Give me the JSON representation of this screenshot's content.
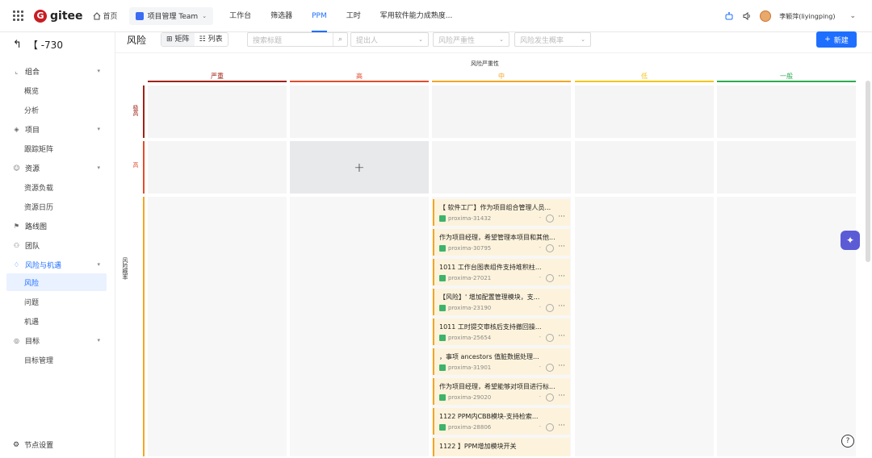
{
  "topbar": {
    "logo_text": "gitee",
    "home_label": "首页",
    "team_label": "项目管理 Team",
    "nav": [
      "工作台",
      "筛选器",
      "PPM",
      "工时",
      "军用软件能力成熟度..."
    ],
    "active_nav": "PPM",
    "user_name": "李颖萍(liyingping)"
  },
  "sidebar": {
    "project_name": "【    -730",
    "items": [
      {
        "type": "group",
        "label": "组合",
        "icon": "chart-icon"
      },
      {
        "type": "sub",
        "label": "概览"
      },
      {
        "type": "sub",
        "label": "分析"
      },
      {
        "type": "group",
        "label": "项目",
        "icon": "layers-icon"
      },
      {
        "type": "sub",
        "label": "跟踪矩阵"
      },
      {
        "type": "group",
        "label": "资源",
        "icon": "person-icon"
      },
      {
        "type": "sub",
        "label": "资源负载"
      },
      {
        "type": "sub",
        "label": "资源日历"
      },
      {
        "type": "single",
        "label": "路线图",
        "icon": "route-icon"
      },
      {
        "type": "single",
        "label": "团队",
        "icon": "team-icon"
      },
      {
        "type": "group",
        "label": "风险与机遇",
        "icon": "bulb-icon",
        "active": true
      },
      {
        "type": "sub",
        "label": "风险",
        "active": true
      },
      {
        "type": "sub",
        "label": "问题"
      },
      {
        "type": "sub",
        "label": "机遇"
      },
      {
        "type": "group",
        "label": "目标",
        "icon": "target-icon"
      },
      {
        "type": "sub",
        "label": "目标管理"
      }
    ],
    "footer_label": "节点设置"
  },
  "toolbar": {
    "title": "风险",
    "view_matrix": "矩阵",
    "view_list": "列表",
    "search_placeholder": "搜索标题",
    "filter_proposer": "提出人",
    "filter_severity": "风险严重性",
    "filter_probability": "风险发生概率",
    "new_label": "新建"
  },
  "matrix": {
    "title": "风险严重性",
    "columns": [
      {
        "label": "严重",
        "color": "#a02214"
      },
      {
        "label": "高",
        "color": "#e24d2c"
      },
      {
        "label": "中",
        "color": "#f5a623"
      },
      {
        "label": "低",
        "color": "#f5c518"
      },
      {
        "label": "一般",
        "color": "#2bab4e"
      }
    ],
    "rows": [
      {
        "label": "极高",
        "color": "#a02214"
      },
      {
        "label": "高",
        "color": "#e24d2c"
      },
      {
        "label": "风险概率",
        "color": "#f5a623"
      }
    ],
    "add_symbol": "+"
  },
  "cards": [
    {
      "title": "【    软件工厂】作为项目组合管理人员...",
      "id": "proxima-31432"
    },
    {
      "title": "作为项目经理，希望管理本项目和其他...",
      "id": "proxima-30795"
    },
    {
      "title": "1011       工作台图表组件支持堆积柱...",
      "id": "proxima-27021"
    },
    {
      "title": "【风险】'     增加配置管理模块，支...",
      "id": "proxima-23190"
    },
    {
      "title": "1011        工时提交审核后支持撤回操...",
      "id": "proxima-25654"
    },
    {
      "title": "    ，事项 ancestors 值脏数据处理...",
      "id": "proxima-31901"
    },
    {
      "title": "作为项目经理，希望能够对项目进行标...",
      "id": "proxima-29020"
    },
    {
      "title": "1122          PPM内CBB模块-支持检索...",
      "id": "proxima-28806"
    },
    {
      "title": "1122        】PPM增加模块开关",
      "id": ""
    }
  ]
}
